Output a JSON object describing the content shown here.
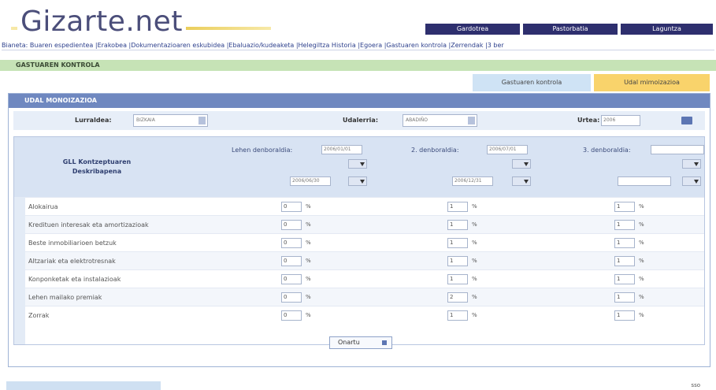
{
  "app": {
    "logo": "Gizarte.net"
  },
  "topnav": [
    "Gardotrea",
    "Pastorbatia",
    "Laguntza"
  ],
  "breadcrumb": "Bianeta: Buaren espedientea |Erakobea |Dokumentazioaren eskubidea |Ebaluazio/kudeaketa |Helegiltza Historia |Egoera |Gastuaren kontrola |Zerrendak |3 ber",
  "section_title": "GASTUAREN KONTROLA",
  "tabs": [
    "Gastuaren kontrola",
    "Udal mimoizazioa"
  ],
  "panel": {
    "title": "UDAL MONOIZAZIOA",
    "filters": {
      "province_label": "Lurraldea:",
      "province_value": "BIZKAIA",
      "municipality_label": "Udalerria:",
      "municipality_value": "ABADIÑO",
      "year_label": "Urtea:",
      "year_value": "2006"
    },
    "table": {
      "desc_header": "GLL Kontzeptuaren Deskribapena",
      "period1_label": "Lehen denboraldia:",
      "period1_from": "2006/01/01",
      "period1_to": "2006/06/30",
      "period2_label": "2. denboraldia:",
      "period2_from": "2006/07/01",
      "period2_to": "2006/12/31",
      "period3_label": "3. denboraldia:",
      "period3_from": "",
      "period3_to": "",
      "rows": [
        {
          "name": "Alokairua",
          "v1": "0",
          "v2": "1",
          "v3": "1"
        },
        {
          "name": "Kredituen interesak eta amortizazioak",
          "v1": "0",
          "v2": "1",
          "v3": "1"
        },
        {
          "name": "Beste inmobiliarioen betzuk",
          "v1": "0",
          "v2": "1",
          "v3": "1"
        },
        {
          "name": "Altzariak eta elektrotresnak",
          "v1": "0",
          "v2": "1",
          "v3": "1"
        },
        {
          "name": "Konponketak eta instalazioak",
          "v1": "0",
          "v2": "1",
          "v3": "1"
        },
        {
          "name": "Lehen mailako premiak",
          "v1": "0",
          "v2": "2",
          "v3": "1"
        },
        {
          "name": "Zorrak",
          "v1": "0",
          "v2": "1",
          "v3": "1"
        }
      ],
      "pct_symbol": "%"
    },
    "ok_button": "Onartu"
  },
  "footer": {
    "right_text": "sso"
  },
  "colors": {
    "nav": "#2e2f6e",
    "header": "#6f88c0",
    "accent_tab": "#f9d36b",
    "section_green": "#c6e3b6"
  }
}
